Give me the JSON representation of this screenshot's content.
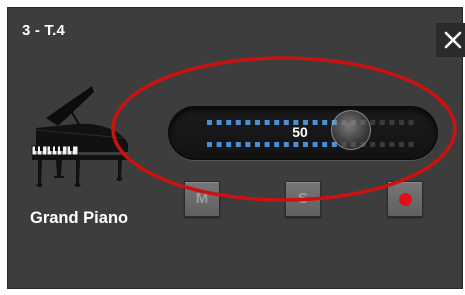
{
  "window": {
    "title": "3 - T.4",
    "close_icon": "close-icon"
  },
  "instrument": {
    "name": "Grand Piano",
    "icon": "grand-piano-icon"
  },
  "volume_slider": {
    "value": "50",
    "level": 0.65
  },
  "buttons": {
    "mute_label": "M",
    "solo_label": "S",
    "record_icon": "record-icon"
  },
  "colors": {
    "panel_bg": "#3d3d3d",
    "led_active": "#4a90d9",
    "led_inactive": "#3a3a3a",
    "record": "#e0101a",
    "annotation": "#cc1111"
  }
}
